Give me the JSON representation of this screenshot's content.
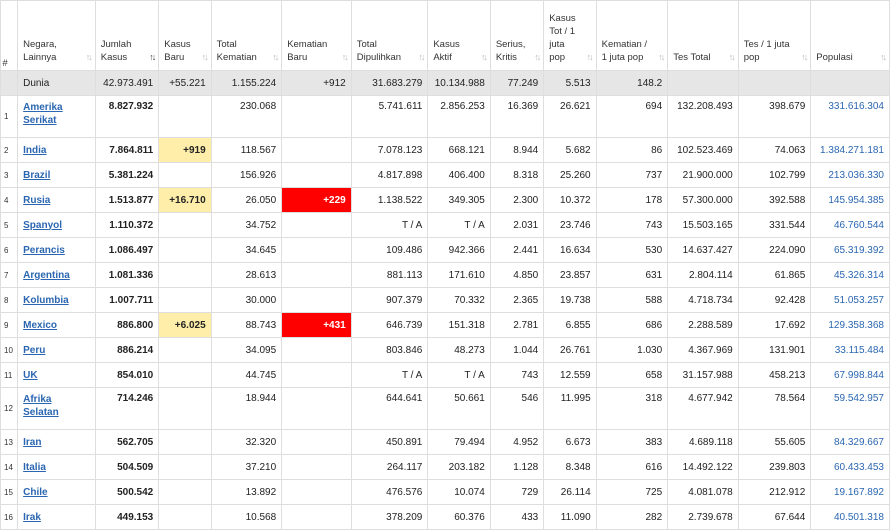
{
  "headers": [
    {
      "key": "idx",
      "label": "#"
    },
    {
      "key": "country",
      "label": "Negara, Lainnya"
    },
    {
      "key": "total_cases",
      "label": "Jumlah Kasus",
      "active": true
    },
    {
      "key": "new_cases",
      "label": "Kasus Baru"
    },
    {
      "key": "total_deaths",
      "label": "Total Kematian"
    },
    {
      "key": "new_deaths",
      "label": "Kematian Baru"
    },
    {
      "key": "total_recovered",
      "label": "Total Dipulihkan"
    },
    {
      "key": "active_cases",
      "label": "Kasus Aktif"
    },
    {
      "key": "serious",
      "label": "Serius, Kritis"
    },
    {
      "key": "cases_per_m",
      "label": "Kasus Tot / 1 juta pop"
    },
    {
      "key": "deaths_per_m",
      "label": "Kematian / 1 juta pop"
    },
    {
      "key": "total_tests",
      "label": "Tes Total"
    },
    {
      "key": "tests_per_m",
      "label": "Tes / 1 juta pop"
    },
    {
      "key": "population",
      "label": "Populasi"
    }
  ],
  "sort_glyph": "↑↓",
  "world": {
    "name": "Dunia",
    "total_cases": "42.973.491",
    "new_cases": "+55.221",
    "total_deaths": "1.155.224",
    "new_deaths": "+912",
    "total_recovered": "31.683.279",
    "active_cases": "10.134.988",
    "serious": "77.249",
    "cases_per_m": "5.513",
    "deaths_per_m": "148.2"
  },
  "rows": [
    {
      "idx": "1",
      "name": "Amerika Serikat",
      "total_cases": "8.827.932",
      "new_cases": "",
      "total_deaths": "230.068",
      "new_deaths": "",
      "total_recovered": "5.741.611",
      "active_cases": "2.856.253",
      "serious": "16.369",
      "cases_per_m": "26.621",
      "deaths_per_m": "694",
      "total_tests": "132.208.493",
      "tests_per_m": "398.679",
      "population": "331.616.304"
    },
    {
      "idx": "2",
      "name": "India",
      "total_cases": "7.864.811",
      "new_cases": "+919",
      "total_deaths": "118.567",
      "new_deaths": "",
      "total_recovered": "7.078.123",
      "active_cases": "668.121",
      "serious": "8.944",
      "cases_per_m": "5.682",
      "deaths_per_m": "86",
      "total_tests": "102.523.469",
      "tests_per_m": "74.063",
      "population": "1.384.271.181"
    },
    {
      "idx": "3",
      "name": "Brazil",
      "total_cases": "5.381.224",
      "new_cases": "",
      "total_deaths": "156.926",
      "new_deaths": "",
      "total_recovered": "4.817.898",
      "active_cases": "406.400",
      "serious": "8.318",
      "cases_per_m": "25.260",
      "deaths_per_m": "737",
      "total_tests": "21.900.000",
      "tests_per_m": "102.799",
      "population": "213.036.330"
    },
    {
      "idx": "4",
      "name": "Rusia",
      "total_cases": "1.513.877",
      "new_cases": "+16.710",
      "total_deaths": "26.050",
      "new_deaths": "+229",
      "total_recovered": "1.138.522",
      "active_cases": "349.305",
      "serious": "2.300",
      "cases_per_m": "10.372",
      "deaths_per_m": "178",
      "total_tests": "57.300.000",
      "tests_per_m": "392.588",
      "population": "145.954.385"
    },
    {
      "idx": "5",
      "name": "Spanyol",
      "total_cases": "1.110.372",
      "new_cases": "",
      "total_deaths": "34.752",
      "new_deaths": "",
      "total_recovered": "T / A",
      "active_cases": "T / A",
      "serious": "2.031",
      "cases_per_m": "23.746",
      "deaths_per_m": "743",
      "total_tests": "15.503.165",
      "tests_per_m": "331.544",
      "population": "46.760.544"
    },
    {
      "idx": "6",
      "name": "Perancis",
      "total_cases": "1.086.497",
      "new_cases": "",
      "total_deaths": "34.645",
      "new_deaths": "",
      "total_recovered": "109.486",
      "active_cases": "942.366",
      "serious": "2.441",
      "cases_per_m": "16.634",
      "deaths_per_m": "530",
      "total_tests": "14.637.427",
      "tests_per_m": "224.090",
      "population": "65.319.392"
    },
    {
      "idx": "7",
      "name": "Argentina",
      "total_cases": "1.081.336",
      "new_cases": "",
      "total_deaths": "28.613",
      "new_deaths": "",
      "total_recovered": "881.113",
      "active_cases": "171.610",
      "serious": "4.850",
      "cases_per_m": "23.857",
      "deaths_per_m": "631",
      "total_tests": "2.804.114",
      "tests_per_m": "61.865",
      "population": "45.326.314"
    },
    {
      "idx": "8",
      "name": "Kolumbia",
      "total_cases": "1.007.711",
      "new_cases": "",
      "total_deaths": "30.000",
      "new_deaths": "",
      "total_recovered": "907.379",
      "active_cases": "70.332",
      "serious": "2.365",
      "cases_per_m": "19.738",
      "deaths_per_m": "588",
      "total_tests": "4.718.734",
      "tests_per_m": "92.428",
      "population": "51.053.257"
    },
    {
      "idx": "9",
      "name": "Mexico",
      "total_cases": "886.800",
      "new_cases": "+6.025",
      "total_deaths": "88.743",
      "new_deaths": "+431",
      "total_recovered": "646.739",
      "active_cases": "151.318",
      "serious": "2.781",
      "cases_per_m": "6.855",
      "deaths_per_m": "686",
      "total_tests": "2.288.589",
      "tests_per_m": "17.692",
      "population": "129.358.368"
    },
    {
      "idx": "10",
      "name": "Peru",
      "total_cases": "886.214",
      "new_cases": "",
      "total_deaths": "34.095",
      "new_deaths": "",
      "total_recovered": "803.846",
      "active_cases": "48.273",
      "serious": "1.044",
      "cases_per_m": "26.761",
      "deaths_per_m": "1.030",
      "total_tests": "4.367.969",
      "tests_per_m": "131.901",
      "population": "33.115.484"
    },
    {
      "idx": "11",
      "name": "UK",
      "total_cases": "854.010",
      "new_cases": "",
      "total_deaths": "44.745",
      "new_deaths": "",
      "total_recovered": "T / A",
      "active_cases": "T / A",
      "serious": "743",
      "cases_per_m": "12.559",
      "deaths_per_m": "658",
      "total_tests": "31.157.988",
      "tests_per_m": "458.213",
      "population": "67.998.844"
    },
    {
      "idx": "12",
      "name": "Afrika Selatan",
      "total_cases": "714.246",
      "new_cases": "",
      "total_deaths": "18.944",
      "new_deaths": "",
      "total_recovered": "644.641",
      "active_cases": "50.661",
      "serious": "546",
      "cases_per_m": "11.995",
      "deaths_per_m": "318",
      "total_tests": "4.677.942",
      "tests_per_m": "78.564",
      "population": "59.542.957"
    },
    {
      "idx": "13",
      "name": "Iran",
      "total_cases": "562.705",
      "new_cases": "",
      "total_deaths": "32.320",
      "new_deaths": "",
      "total_recovered": "450.891",
      "active_cases": "79.494",
      "serious": "4.952",
      "cases_per_m": "6.673",
      "deaths_per_m": "383",
      "total_tests": "4.689.118",
      "tests_per_m": "55.605",
      "population": "84.329.667"
    },
    {
      "idx": "14",
      "name": "Italia",
      "total_cases": "504.509",
      "new_cases": "",
      "total_deaths": "37.210",
      "new_deaths": "",
      "total_recovered": "264.117",
      "active_cases": "203.182",
      "serious": "1.128",
      "cases_per_m": "8.348",
      "deaths_per_m": "616",
      "total_tests": "14.492.122",
      "tests_per_m": "239.803",
      "population": "60.433.453"
    },
    {
      "idx": "15",
      "name": "Chile",
      "total_cases": "500.542",
      "new_cases": "",
      "total_deaths": "13.892",
      "new_deaths": "",
      "total_recovered": "476.576",
      "active_cases": "10.074",
      "serious": "729",
      "cases_per_m": "26.114",
      "deaths_per_m": "725",
      "total_tests": "4.081.078",
      "tests_per_m": "212.912",
      "population": "19.167.892"
    },
    {
      "idx": "16",
      "name": "Irak",
      "total_cases": "449.153",
      "new_cases": "",
      "total_deaths": "10.568",
      "new_deaths": "",
      "total_recovered": "378.209",
      "active_cases": "60.376",
      "serious": "433",
      "cases_per_m": "11.090",
      "deaths_per_m": "282",
      "total_tests": "2.739.678",
      "tests_per_m": "67.644",
      "population": "40.501.318"
    }
  ],
  "colors": {
    "highlight_new_cases": "#ffeeaa",
    "highlight_new_deaths": "#ff0000",
    "link": "#2a66b1",
    "world_row": "#e6e6e6"
  }
}
